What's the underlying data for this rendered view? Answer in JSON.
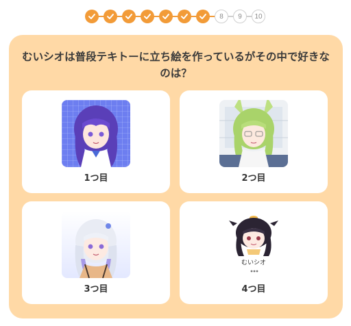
{
  "progress": {
    "steps": [
      {
        "label": "1",
        "done": true
      },
      {
        "label": "2",
        "done": true
      },
      {
        "label": "3",
        "done": true
      },
      {
        "label": "4",
        "done": true
      },
      {
        "label": "5",
        "done": true
      },
      {
        "label": "6",
        "done": true
      },
      {
        "label": "7",
        "done": true
      },
      {
        "label": "8",
        "done": false
      },
      {
        "label": "9",
        "done": false
      },
      {
        "label": "10",
        "done": false
      }
    ],
    "accent_color": "#f29b38"
  },
  "quiz": {
    "question": "むいシオは普段テキトーに立ち絵を作っているがその中で好きなのは？",
    "panel_color": "#ffd9a6",
    "options": [
      {
        "label": "1つ目",
        "image": "purple-hair-girl-portrait"
      },
      {
        "label": "2つ目",
        "image": "green-hair-cat-ear-girl-portrait"
      },
      {
        "label": "3つ目",
        "image": "silver-hair-girl-portrait"
      },
      {
        "label": "4つ目",
        "image": "chibi-black-hair-girl-with-logo"
      }
    ],
    "logo_text": "むいシオ"
  }
}
